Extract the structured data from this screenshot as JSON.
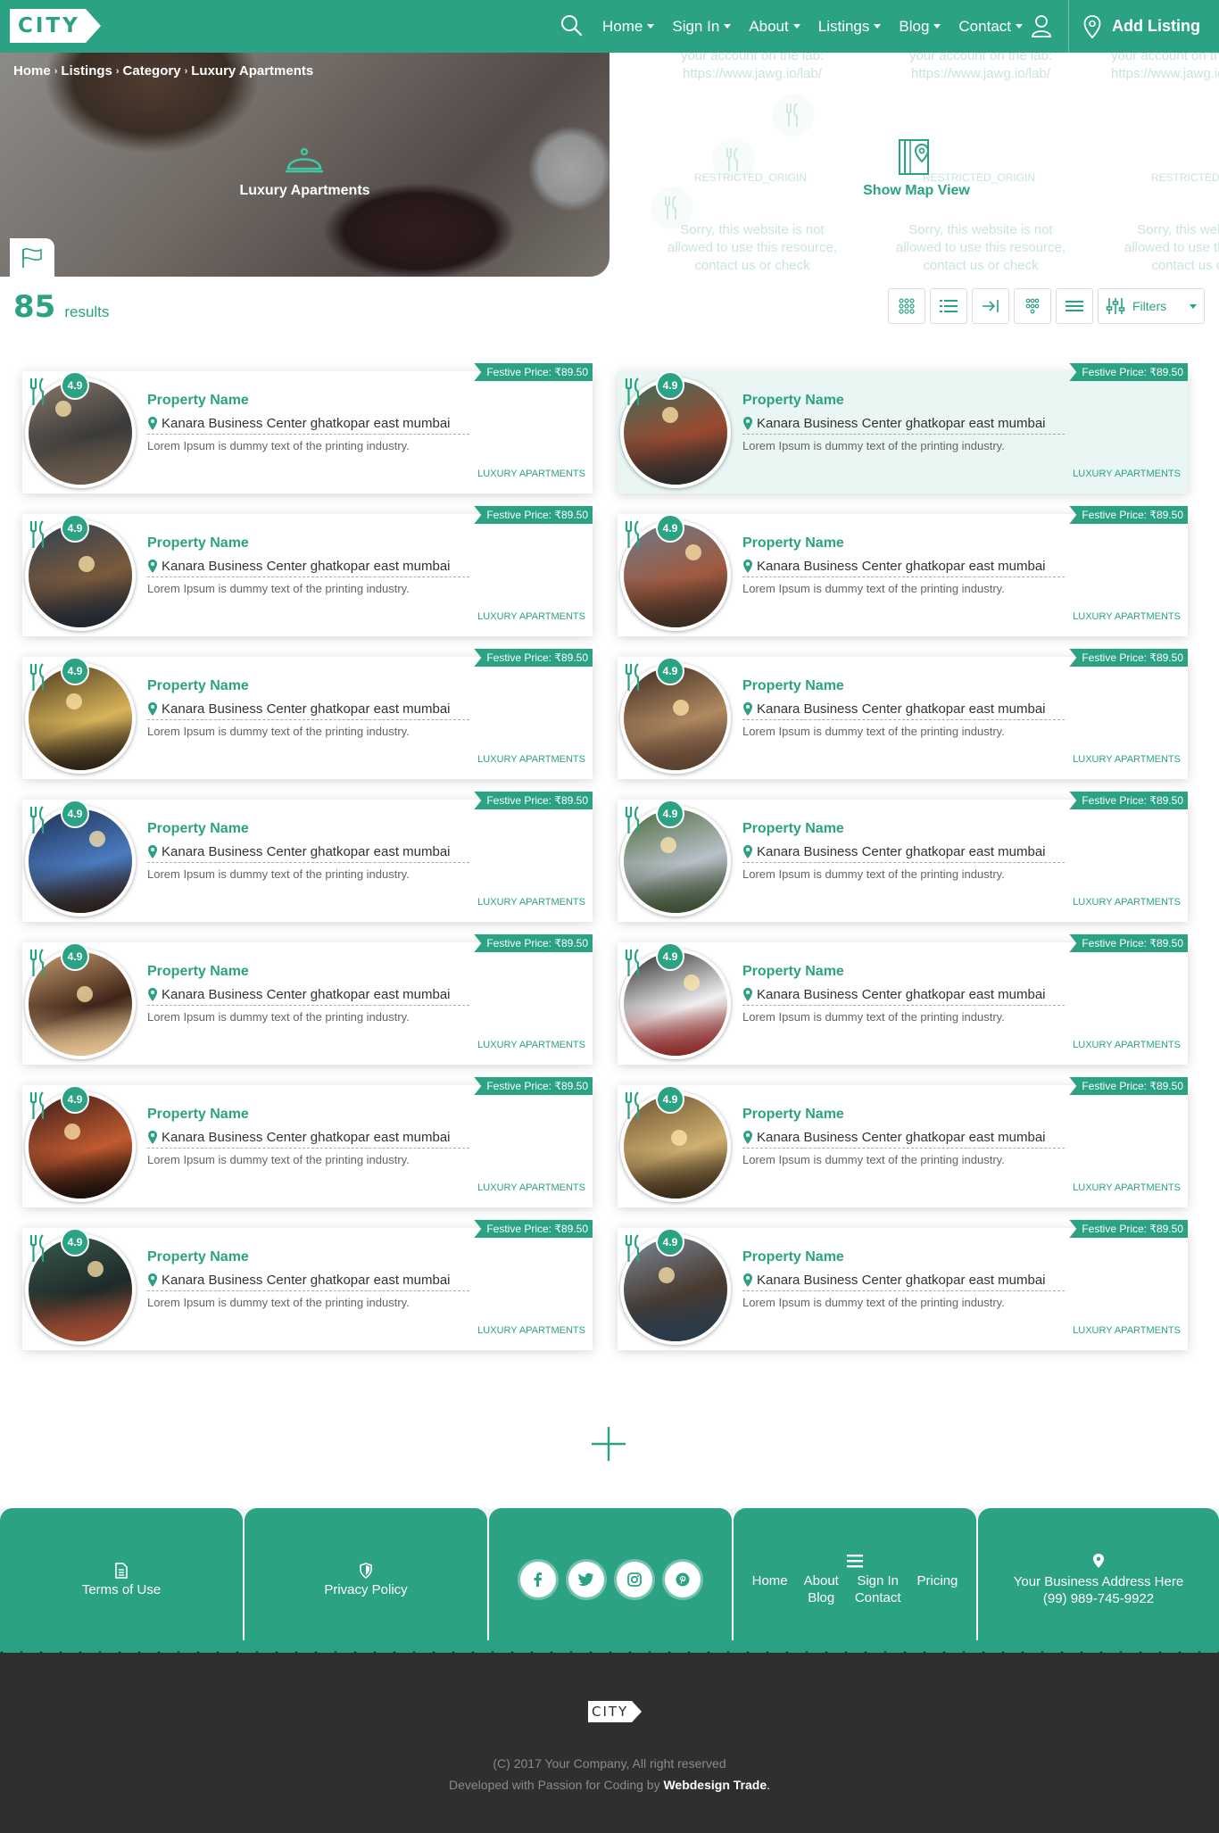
{
  "brand": {
    "logo_text": "CITY"
  },
  "nav": {
    "items": [
      {
        "label": "Home"
      },
      {
        "label": "Sign In"
      },
      {
        "label": "About"
      },
      {
        "label": "Listings"
      },
      {
        "label": "Blog"
      },
      {
        "label": "Contact"
      }
    ],
    "add_listing": "Add Listing"
  },
  "breadcrumb": [
    "Home",
    "Listings",
    "Category",
    "Luxury Apartments"
  ],
  "hero": {
    "title": "Luxury Apartments"
  },
  "map": {
    "url_line1": "your account on the lab:",
    "url_line2": "https://www.jawg.io/lab/",
    "error_code": "RESTRICTED_ORIGIN",
    "error_line1": "Sorry, this website is not",
    "error_line2": "allowed to use this resource,",
    "error_line3": "contact us or check",
    "show_map": "Show Map View"
  },
  "results": {
    "count": "85",
    "label": "results"
  },
  "toolbar": {
    "filters_label": "Filters"
  },
  "listing_template": {
    "rating": "4.9",
    "price": "Festive Price: ₹89.50",
    "name": "Property Name",
    "address": "Kanara Business Center ghatkopar east mumbai",
    "description": "Lorem Ipsum is dummy text of the printing industry.",
    "category": "LUXURY APARTMENTS"
  },
  "listings": [
    {
      "rating": "4.9",
      "price": "Festive Price: ₹89.50",
      "name": "Property Name",
      "address": "Kanara Business Center ghatkopar east mumbai",
      "description": "Lorem Ipsum is dummy text of the printing industry.",
      "category": "LUXURY APARTMENTS",
      "highlighted": false
    },
    {
      "rating": "4.9",
      "price": "Festive Price: ₹89.50",
      "name": "Property Name",
      "address": "Kanara Business Center ghatkopar east mumbai",
      "description": "Lorem Ipsum is dummy text of the printing industry.",
      "category": "LUXURY APARTMENTS",
      "highlighted": true
    },
    {
      "rating": "4.9",
      "price": "Festive Price: ₹89.50",
      "name": "Property Name",
      "address": "Kanara Business Center ghatkopar east mumbai",
      "description": "Lorem Ipsum is dummy text of the printing industry.",
      "category": "LUXURY APARTMENTS",
      "highlighted": false
    },
    {
      "rating": "4.9",
      "price": "Festive Price: ₹89.50",
      "name": "Property Name",
      "address": "Kanara Business Center ghatkopar east mumbai",
      "description": "Lorem Ipsum is dummy text of the printing industry.",
      "category": "LUXURY APARTMENTS",
      "highlighted": false
    },
    {
      "rating": "4.9",
      "price": "Festive Price: ₹89.50",
      "name": "Property Name",
      "address": "Kanara Business Center ghatkopar east mumbai",
      "description": "Lorem Ipsum is dummy text of the printing industry.",
      "category": "LUXURY APARTMENTS",
      "highlighted": false
    },
    {
      "rating": "4.9",
      "price": "Festive Price: ₹89.50",
      "name": "Property Name",
      "address": "Kanara Business Center ghatkopar east mumbai",
      "description": "Lorem Ipsum is dummy text of the printing industry.",
      "category": "LUXURY APARTMENTS",
      "highlighted": false
    },
    {
      "rating": "4.9",
      "price": "Festive Price: ₹89.50",
      "name": "Property Name",
      "address": "Kanara Business Center ghatkopar east mumbai",
      "description": "Lorem Ipsum is dummy text of the printing industry.",
      "category": "LUXURY APARTMENTS",
      "highlighted": false
    },
    {
      "rating": "4.9",
      "price": "Festive Price: ₹89.50",
      "name": "Property Name",
      "address": "Kanara Business Center ghatkopar east mumbai",
      "description": "Lorem Ipsum is dummy text of the printing industry.",
      "category": "LUXURY APARTMENTS",
      "highlighted": false
    },
    {
      "rating": "4.9",
      "price": "Festive Price: ₹89.50",
      "name": "Property Name",
      "address": "Kanara Business Center ghatkopar east mumbai",
      "description": "Lorem Ipsum is dummy text of the printing industry.",
      "category": "LUXURY APARTMENTS",
      "highlighted": false
    },
    {
      "rating": "4.9",
      "price": "Festive Price: ₹89.50",
      "name": "Property Name",
      "address": "Kanara Business Center ghatkopar east mumbai",
      "description": "Lorem Ipsum is dummy text of the printing industry.",
      "category": "LUXURY APARTMENTS",
      "highlighted": false
    },
    {
      "rating": "4.9",
      "price": "Festive Price: ₹89.50",
      "name": "Property Name",
      "address": "Kanara Business Center ghatkopar east mumbai",
      "description": "Lorem Ipsum is dummy text of the printing industry.",
      "category": "LUXURY APARTMENTS",
      "highlighted": false
    },
    {
      "rating": "4.9",
      "price": "Festive Price: ₹89.50",
      "name": "Property Name",
      "address": "Kanara Business Center ghatkopar east mumbai",
      "description": "Lorem Ipsum is dummy text of the printing industry.",
      "category": "LUXURY APARTMENTS",
      "highlighted": false
    },
    {
      "rating": "4.9",
      "price": "Festive Price: ₹89.50",
      "name": "Property Name",
      "address": "Kanara Business Center ghatkopar east mumbai",
      "description": "Lorem Ipsum is dummy text of the printing industry.",
      "category": "LUXURY APARTMENTS",
      "highlighted": false
    },
    {
      "rating": "4.9",
      "price": "Festive Price: ₹89.50",
      "name": "Property Name",
      "address": "Kanara Business Center ghatkopar east mumbai",
      "description": "Lorem Ipsum is dummy text of the printing industry.",
      "category": "LUXURY APARTMENTS",
      "highlighted": false
    }
  ],
  "footer": {
    "terms": "Terms of Use",
    "privacy": "Privacy Policy",
    "menu": [
      "Home",
      "About",
      "Sign In",
      "Pricing",
      "Blog",
      "Contact"
    ],
    "address": "Your Business Address Here",
    "phone": "(99) 989-745-9922",
    "copyright": "(C) 2017 Your Company, All right reserved",
    "dev_prefix": "Developed with Passion for Coding by",
    "dev_name": "Webdesign Trade",
    "dev_suffix": "."
  },
  "colors": {
    "accent": "#2ba283",
    "footer_dark": "#302f2f"
  },
  "icons": [
    "search-icon",
    "user-icon",
    "map-pin-icon",
    "bell-icon",
    "flag-icon",
    "book-map-icon",
    "fork-knife-icon",
    "grid-icon",
    "list-icon",
    "facebook-icon",
    "twitter-icon",
    "instagram-icon",
    "pinterest-icon",
    "document-icon",
    "shield-icon",
    "menu-icon",
    "plus-icon"
  ]
}
